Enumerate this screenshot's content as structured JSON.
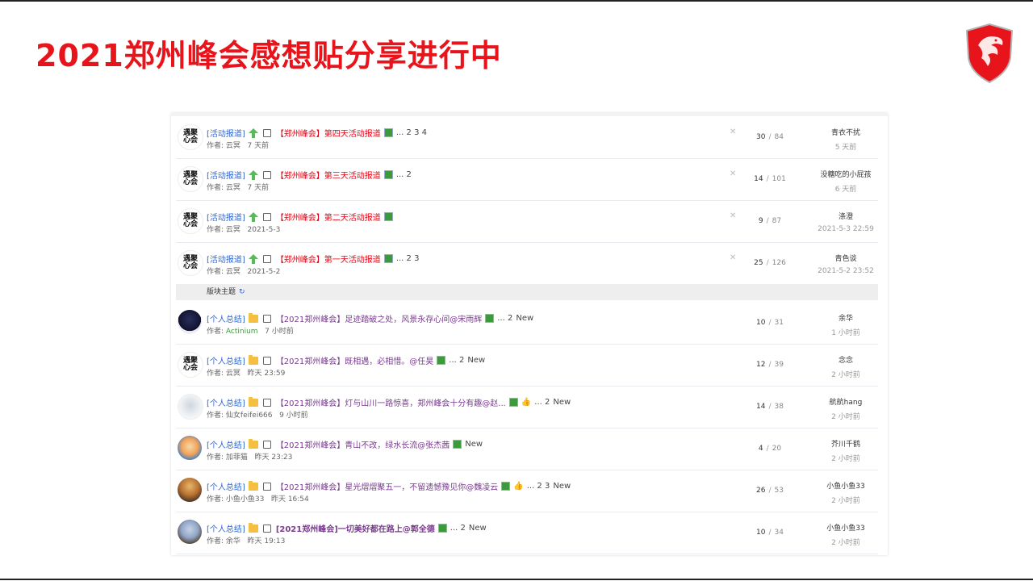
{
  "slide_title": "2021郑州峰会感想贴分享进行中",
  "brand_colors": {
    "accent": "#e8141b",
    "category": "#3366cc",
    "sticky_title": "#e60012",
    "normal_title": "#7a3b8f"
  },
  "sticky_threads": [
    {
      "category": "[活动报道]",
      "title": "【郑州峰会】第四天活动报道",
      "pages": "... 2  3  4",
      "author": "作者: 云冥",
      "date": "7 天前",
      "replies": "30",
      "views": "84",
      "last_user": "青衣不扰",
      "last_time": "5 天前"
    },
    {
      "category": "[活动报道]",
      "title": "【郑州峰会】第三天活动报道",
      "pages": "... 2",
      "author": "作者: 云冥",
      "date": "7 天前",
      "replies": "14",
      "views": "101",
      "last_user": "没糖吃的小屁孩",
      "last_time": "6 天前"
    },
    {
      "category": "[活动报道]",
      "title": "【郑州峰会】第二天活动报道",
      "pages": "",
      "author": "作者: 云冥",
      "date": "2021-5-3",
      "replies": "9",
      "views": "87",
      "last_user": "涤澄",
      "last_time": "2021-5-3 22:59"
    },
    {
      "category": "[活动报道]",
      "title": "【郑州峰会】第一天活动报道",
      "pages": "... 2  3",
      "author": "作者: 云冥",
      "date": "2021-5-2",
      "replies": "25",
      "views": "126",
      "last_user": "青色谈",
      "last_time": "2021-5-2 23:52"
    }
  ],
  "section_label": "版块主题",
  "threads": [
    {
      "category": "[个人总结]",
      "title": "【2021郑州峰会】足迹踏破之处，风景永存心间@宋雨辉",
      "pages": "... 2",
      "new": "New",
      "author_label": "作者: ",
      "author": "Actinium",
      "date": "7 小时前",
      "replies": "10",
      "views": "31",
      "last_user": "余华",
      "last_time": "1 小时前"
    },
    {
      "category": "[个人总结]",
      "title": "【2021郑州峰会】既相遇，必相惜。@任昊",
      "pages": "... 2",
      "new": "New",
      "author_label": "作者: ",
      "author": "云冥",
      "date": "昨天 23:59",
      "replies": "12",
      "views": "39",
      "last_user": "念念",
      "last_time": "2 小时前"
    },
    {
      "category": "[个人总结]",
      "title": "【2021郑州峰会】灯与山川一路惊喜，郑州峰会十分有趣@赵...",
      "pages": "... 2",
      "new": "New",
      "author_label": "作者: ",
      "author": "仙女feifei666",
      "date": "9 小时前",
      "replies": "14",
      "views": "38",
      "last_user": "航航hang",
      "last_time": "2 小时前"
    },
    {
      "category": "[个人总结]",
      "title": "【2021郑州峰会】青山不改，绿水长流@张杰茜",
      "pages": "",
      "new": "New",
      "author_label": "作者: ",
      "author": "加菲猫",
      "date": "昨天 23:23",
      "replies": "4",
      "views": "20",
      "last_user": "芥川千鹤",
      "last_time": "2 小时前"
    },
    {
      "category": "[个人总结]",
      "title": "【2021郑州峰会】星光熠熠聚五一，不留遗憾豫见你@魏凌云",
      "pages": "... 2  3",
      "new": "New",
      "author_label": "作者: ",
      "author": "小鱼小鱼33",
      "date": "昨天 16:54",
      "replies": "26",
      "views": "53",
      "last_user": "小鱼小鱼33",
      "last_time": "2 小时前"
    },
    {
      "category": "[个人总结]",
      "title": "[2021郑州峰会]一切美好都在路上@郭全德",
      "pages": "... 2",
      "new": "New",
      "author_label": "作者: ",
      "author": "余华",
      "date": "昨天 19:13",
      "replies": "10",
      "views": "34",
      "last_user": "小鱼小鱼33",
      "last_time": "2 小时前"
    }
  ],
  "avatar_text": "遇聚\n心会",
  "icons": {
    "sticky": "green-up-arrow-icon",
    "folder": "folder-icon",
    "image": "image-attachment-icon",
    "thumb": "thumbs-up-icon",
    "close": "close-icon",
    "refresh": "refresh-icon",
    "logo": "msi-dragon-shield-logo"
  }
}
